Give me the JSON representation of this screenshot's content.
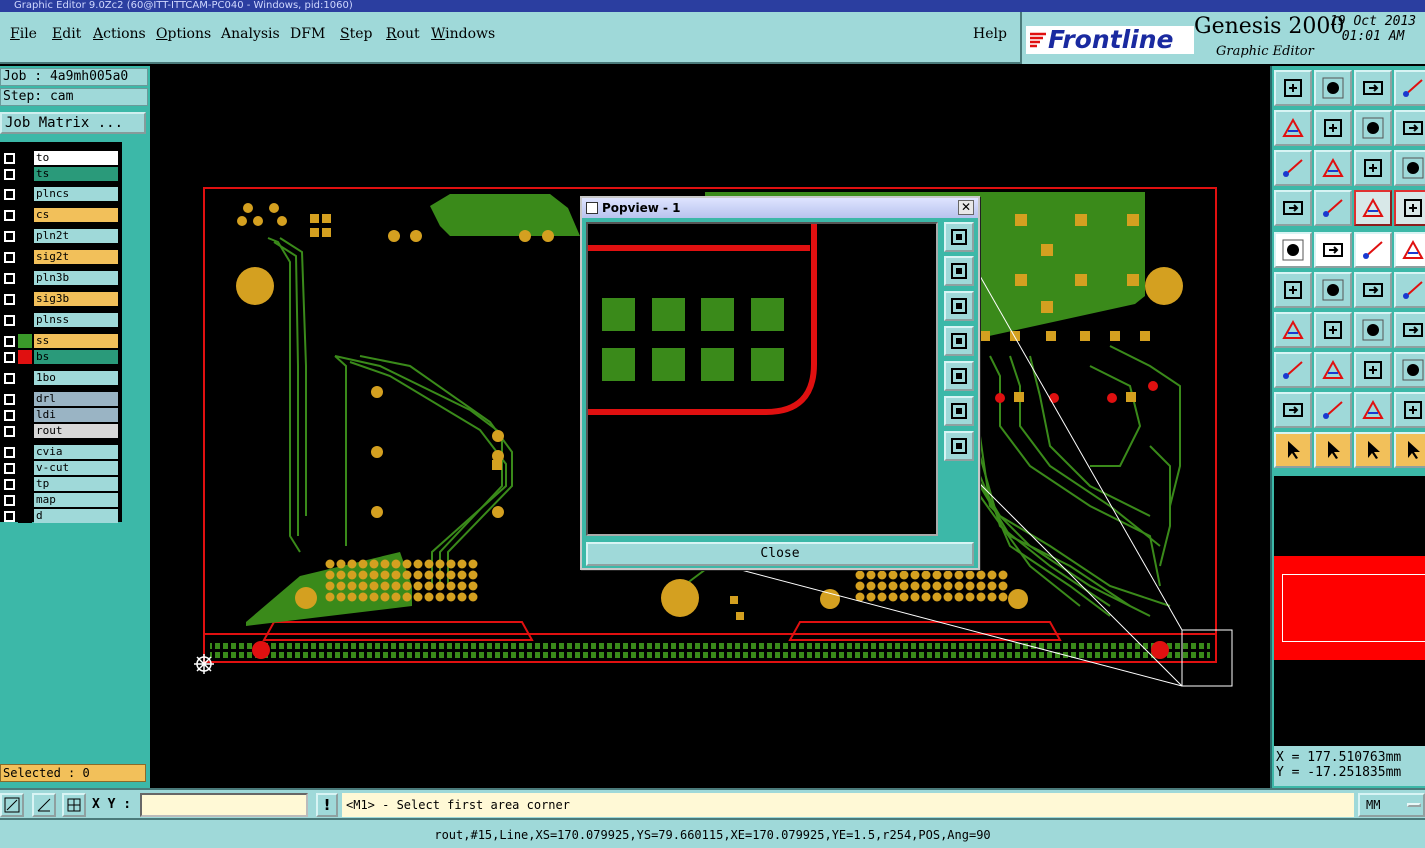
{
  "window": {
    "title": "Graphic Editor 9.0Zc2 (60@ITT-ITTCAM-PC040 - Windows, pid:1060)"
  },
  "menu": {
    "items": [
      {
        "key": "F",
        "rest": "ile"
      },
      {
        "key": "E",
        "rest": "dit"
      },
      {
        "key": "A",
        "rest": "ctions"
      },
      {
        "key": "O",
        "rest": "ptions"
      },
      {
        "key": "",
        "rest": "Analysis"
      },
      {
        "key": "",
        "rest": "DFM"
      },
      {
        "key": "S",
        "rest": "tep"
      },
      {
        "key": "R",
        "rest": "out"
      },
      {
        "key": "W",
        "rest": "indows"
      }
    ],
    "help": "Help"
  },
  "brand": {
    "logo": "Frontline",
    "product": "Genesis 2000",
    "subtitle": "Graphic Editor",
    "date": "19 Oct 2013",
    "time": "01:01 AM"
  },
  "job": {
    "job_line": "Job : 4a9mh005a0",
    "step_line": "Step: cam",
    "matrix_button": "Job Matrix ..."
  },
  "layers": [
    {
      "name": "to",
      "swatch": "#000000",
      "bg": "#ffffff"
    },
    {
      "name": "ts",
      "swatch": "#000000",
      "bg": "#2a9a7a"
    },
    {
      "name": "plncs",
      "swatch": "#000000",
      "bg": "#9fd9d9"
    },
    {
      "name": "cs",
      "swatch": "#000000",
      "bg": "#f2c05a"
    },
    {
      "name": "pln2t",
      "swatch": "#000000",
      "bg": "#9fd9d9"
    },
    {
      "name": "sig2t",
      "swatch": "#000000",
      "bg": "#f2c05a"
    },
    {
      "name": "pln3b",
      "swatch": "#000000",
      "bg": "#9fd9d9"
    },
    {
      "name": "sig3b",
      "swatch": "#000000",
      "bg": "#f2c05a"
    },
    {
      "name": "plnss",
      "swatch": "#000000",
      "bg": "#9fd9d9"
    },
    {
      "name": "ss",
      "swatch": "#3a9a2a",
      "bg": "#f2c05a"
    },
    {
      "name": "bs",
      "swatch": "#e01010",
      "bg": "#2a9a7a"
    },
    {
      "name": "1bo",
      "swatch": "#000000",
      "bg": "#9fd9d9"
    },
    {
      "name": "drl",
      "swatch": "#000000",
      "bg": "#9ab4c4"
    },
    {
      "name": "ldi",
      "swatch": "#000000",
      "bg": "#9ab4c4"
    },
    {
      "name": "rout",
      "swatch": "#000000",
      "bg": "#d8d8d8"
    },
    {
      "name": "cvia",
      "swatch": "#000000",
      "bg": "#9fd9d9"
    },
    {
      "name": "v-cut",
      "swatch": "#000000",
      "bg": "#9fd9d9"
    },
    {
      "name": "tp",
      "swatch": "#000000",
      "bg": "#9fd9d9"
    },
    {
      "name": "map",
      "swatch": "#000000",
      "bg": "#9fd9d9"
    },
    {
      "name": "d",
      "swatch": "#000000",
      "bg": "#9fd9d9"
    }
  ],
  "selected": "Selected : 0",
  "coords": {
    "x": "X =  177.510763mm",
    "y": "Y =  -17.251835mm"
  },
  "command": {
    "xy_label": "X Y :",
    "xy_value": "",
    "warn": "!",
    "prompt": "<M1> - Select first area corner",
    "units": "MM"
  },
  "status": "rout,#15,Line,XS=170.079925,YS=79.660115,XE=170.079925,YE=1.5,r254,POS,Ang=90",
  "popview": {
    "title": "Popview - 1",
    "close_x": "✕",
    "close_button": "Close"
  },
  "colors": {
    "copper": "#3a8a1a",
    "pad": "#d4a020",
    "outline": "#e01010",
    "panel": "#9fd9d9"
  }
}
